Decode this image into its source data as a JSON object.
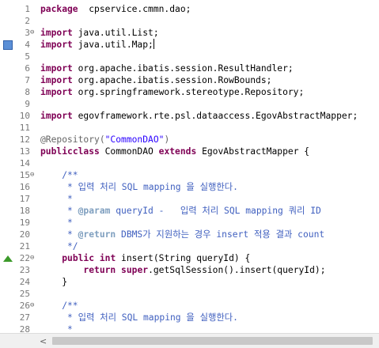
{
  "editor": {
    "lines": [
      {
        "n": "1",
        "fold": "",
        "segs": [
          [
            "kw",
            "package"
          ],
          [
            "",
            "  cpservice.cmmn.dao;"
          ]
        ]
      },
      {
        "n": "2",
        "fold": "",
        "segs": []
      },
      {
        "n": "3",
        "fold": "⊖",
        "segs": [
          [
            "kw",
            "import"
          ],
          [
            "",
            " java.util.List;"
          ]
        ]
      },
      {
        "n": "4",
        "fold": "",
        "marker": "bookmark",
        "segs": [
          [
            "kw",
            "import"
          ],
          [
            "",
            " java.util.Map;"
          ],
          [
            "cursor",
            ""
          ]
        ]
      },
      {
        "n": "5",
        "fold": "",
        "segs": []
      },
      {
        "n": "6",
        "fold": "",
        "segs": [
          [
            "kw",
            "import"
          ],
          [
            "",
            " org.apache.ibatis.session.ResultHandler;"
          ]
        ]
      },
      {
        "n": "7",
        "fold": "",
        "segs": [
          [
            "kw",
            "import"
          ],
          [
            "",
            " org.apache.ibatis.session.RowBounds;"
          ]
        ]
      },
      {
        "n": "8",
        "fold": "",
        "segs": [
          [
            "kw",
            "import"
          ],
          [
            "",
            " org.springframework.stereotype.Repository;"
          ]
        ]
      },
      {
        "n": "9",
        "fold": "",
        "segs": []
      },
      {
        "n": "10",
        "fold": "",
        "segs": [
          [
            "kw",
            "import"
          ],
          [
            "",
            " egovframework.rte.psl.dataaccess.EgovAbstractMapper;"
          ]
        ]
      },
      {
        "n": "11",
        "fold": "",
        "segs": []
      },
      {
        "n": "12",
        "fold": "",
        "segs": [
          [
            "ann",
            "@Repository("
          ],
          [
            "str",
            "\"CommonDAO\""
          ],
          [
            "ann",
            ")"
          ]
        ]
      },
      {
        "n": "13",
        "fold": "",
        "segs": [
          [
            "kw",
            "public"
          ],
          [
            " ",
            ""
          ],
          [
            "kw",
            "class"
          ],
          [
            "",
            " CommonDAO "
          ],
          [
            "kw",
            "extends"
          ],
          [
            "",
            " EgovAbstractMapper {"
          ]
        ]
      },
      {
        "n": "14",
        "fold": "",
        "segs": []
      },
      {
        "n": "15",
        "fold": "⊖",
        "segs": [
          [
            "doc",
            "    /**"
          ]
        ]
      },
      {
        "n": "16",
        "fold": "",
        "segs": [
          [
            "doc",
            "     * 입력 처리 SQL mapping 을 실행한다."
          ]
        ]
      },
      {
        "n": "17",
        "fold": "",
        "segs": [
          [
            "doc",
            "     *"
          ]
        ]
      },
      {
        "n": "18",
        "fold": "",
        "segs": [
          [
            "doc",
            "     * "
          ],
          [
            "tag",
            "@param"
          ],
          [
            "doc",
            " queryId -   입력 처리 SQL mapping 쿼리 ID"
          ]
        ]
      },
      {
        "n": "19",
        "fold": "",
        "segs": [
          [
            "doc",
            "     *"
          ]
        ]
      },
      {
        "n": "20",
        "fold": "",
        "segs": [
          [
            "doc",
            "     * "
          ],
          [
            "tag",
            "@return"
          ],
          [
            "doc",
            " DBMS가 지원하는 경우 insert 적용 결과 count"
          ]
        ]
      },
      {
        "n": "21",
        "fold": "",
        "segs": [
          [
            "doc",
            "     */"
          ]
        ]
      },
      {
        "n": "22",
        "fold": "⊖",
        "marker": "override",
        "segs": [
          [
            "",
            "    "
          ],
          [
            "kw",
            "public"
          ],
          [
            "",
            " "
          ],
          [
            "kw",
            "int"
          ],
          [
            "",
            " insert(String queryId) {"
          ]
        ]
      },
      {
        "n": "23",
        "fold": "",
        "segs": [
          [
            "",
            "        "
          ],
          [
            "kw",
            "return"
          ],
          [
            "",
            " "
          ],
          [
            "kw",
            "super"
          ],
          [
            "",
            ".getSqlSession().insert(queryId);"
          ]
        ]
      },
      {
        "n": "24",
        "fold": "",
        "segs": [
          [
            "",
            "    }"
          ]
        ]
      },
      {
        "n": "25",
        "fold": "",
        "segs": []
      },
      {
        "n": "26",
        "fold": "⊖",
        "segs": [
          [
            "doc",
            "    /**"
          ]
        ]
      },
      {
        "n": "27",
        "fold": "",
        "segs": [
          [
            "doc",
            "     * 입력 처리 SQL mapping 을 실행한다."
          ]
        ]
      },
      {
        "n": "28",
        "fold": "",
        "segs": [
          [
            "doc",
            "     *"
          ]
        ]
      }
    ]
  },
  "scrollbar": {
    "left_arrow": "<"
  }
}
